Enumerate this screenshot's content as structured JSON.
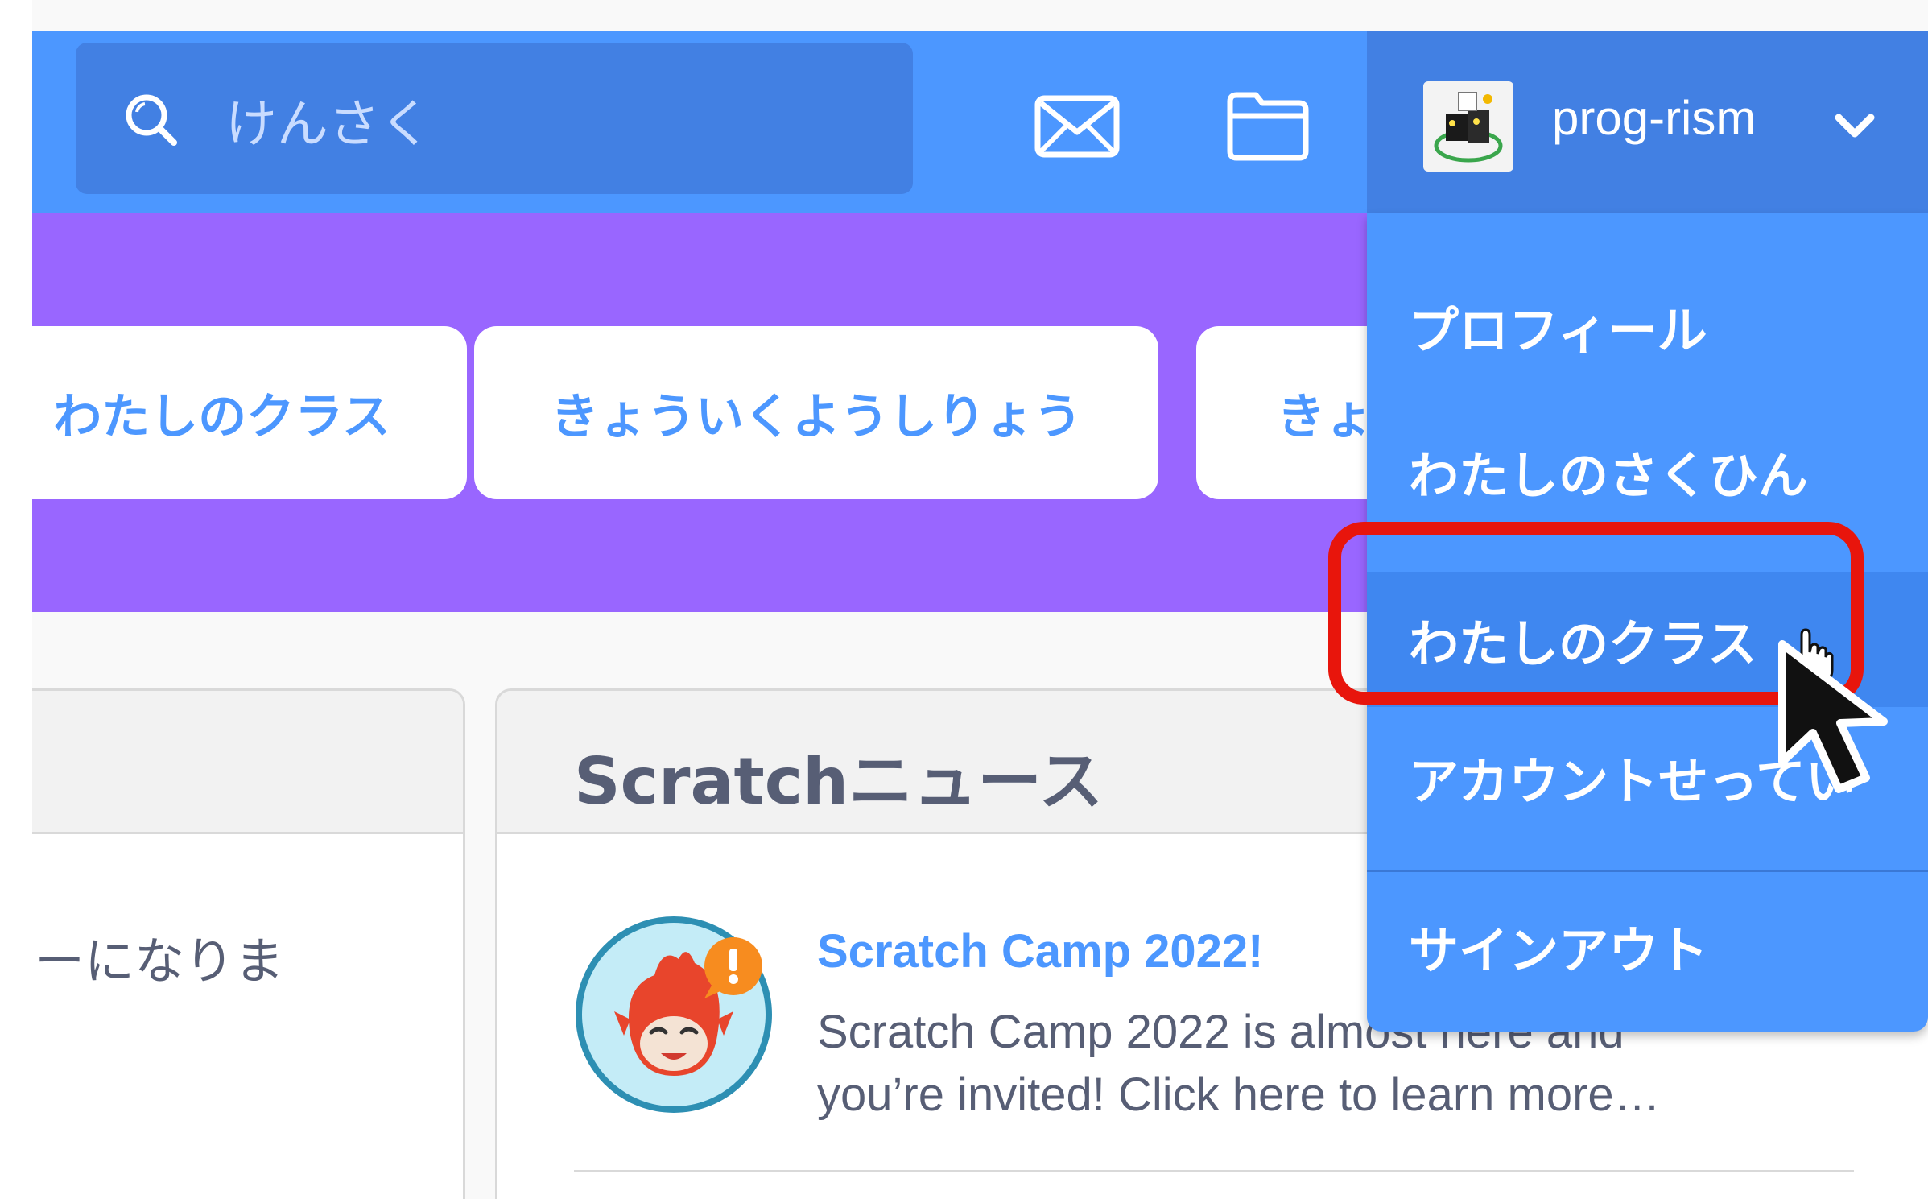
{
  "header": {
    "search": {
      "placeholder": "けんさく",
      "icon": "search-icon"
    },
    "messages_icon": "envelope-icon",
    "my_stuff_icon": "folder-icon",
    "user": {
      "name": "prog-rism",
      "icon": "chevron-down-icon"
    }
  },
  "banner": {
    "buttons": [
      {
        "label": "わたしのクラス"
      },
      {
        "label": "きょういくようしりょう"
      },
      {
        "label": "きょ"
      }
    ]
  },
  "left_panel": {
    "text": "ーになりま"
  },
  "news": {
    "title": "Scratchニュース",
    "items": [
      {
        "title": "Scratch Camp 2022!",
        "description": "Scratch Camp 2022 is almost here and you’re invited! Click here to learn more…"
      }
    ]
  },
  "account_menu": {
    "items": [
      {
        "label": "プロフィール"
      },
      {
        "label": "わたしのさくひん"
      },
      {
        "label": "わたしのクラス"
      },
      {
        "label": "アカウントせってい"
      },
      {
        "label": "サインアウト"
      }
    ]
  },
  "colors": {
    "navbar": "#4c97ff",
    "banner": "#9966ff",
    "highlight": "#e8150c",
    "text": "#575e75"
  }
}
